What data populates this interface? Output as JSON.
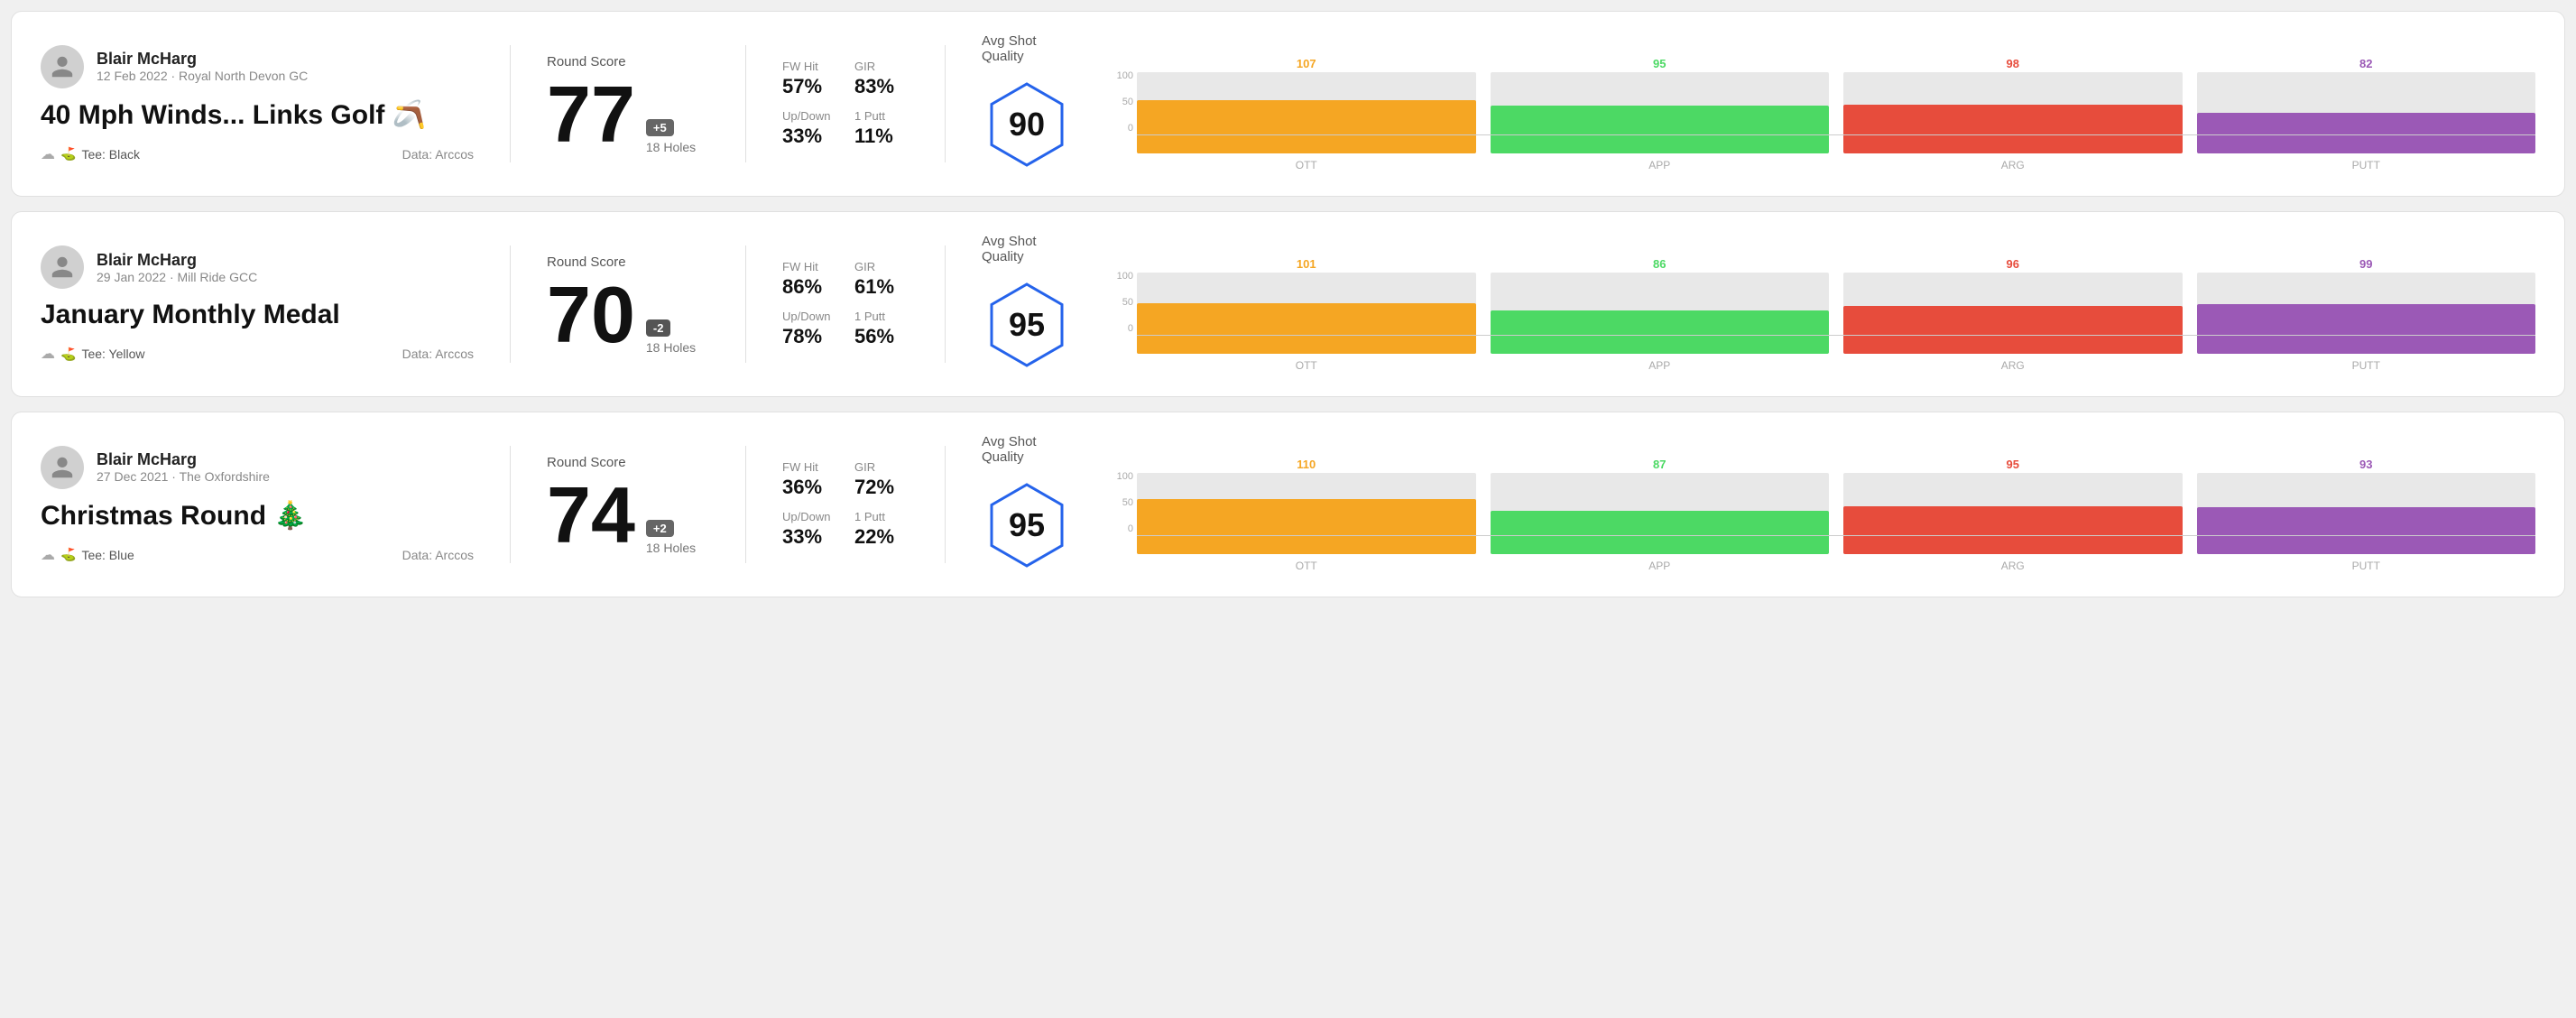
{
  "rounds": [
    {
      "id": "round1",
      "user_name": "Blair McHarg",
      "user_date": "12 Feb 2022 · Royal North Devon GC",
      "title": "40 Mph Winds... Links Golf 🪃",
      "tee": "Black",
      "data_source": "Data: Arccos",
      "score": "77",
      "score_diff": "+5",
      "score_diff_sign": "positive",
      "holes": "18 Holes",
      "fw_hit": "57%",
      "gir": "83%",
      "up_down": "33%",
      "one_putt": "11%",
      "avg_shot_quality": "90",
      "chart": {
        "bars": [
          {
            "label": "OTT",
            "value": 107,
            "color": "#f5a623",
            "max": 130
          },
          {
            "label": "APP",
            "value": 95,
            "color": "#4cd964",
            "max": 130
          },
          {
            "label": "ARG",
            "value": 98,
            "color": "#e74c3c",
            "max": 130
          },
          {
            "label": "PUTT",
            "value": 82,
            "color": "#9b59b6",
            "max": 130
          }
        ]
      }
    },
    {
      "id": "round2",
      "user_name": "Blair McHarg",
      "user_date": "29 Jan 2022 · Mill Ride GCC",
      "title": "January Monthly Medal",
      "tee": "Yellow",
      "data_source": "Data: Arccos",
      "score": "70",
      "score_diff": "-2",
      "score_diff_sign": "negative",
      "holes": "18 Holes",
      "fw_hit": "86%",
      "gir": "61%",
      "up_down": "78%",
      "one_putt": "56%",
      "avg_shot_quality": "95",
      "chart": {
        "bars": [
          {
            "label": "OTT",
            "value": 101,
            "color": "#f5a623",
            "max": 130
          },
          {
            "label": "APP",
            "value": 86,
            "color": "#4cd964",
            "max": 130
          },
          {
            "label": "ARG",
            "value": 96,
            "color": "#e74c3c",
            "max": 130
          },
          {
            "label": "PUTT",
            "value": 99,
            "color": "#9b59b6",
            "max": 130
          }
        ]
      }
    },
    {
      "id": "round3",
      "user_name": "Blair McHarg",
      "user_date": "27 Dec 2021 · The Oxfordshire",
      "title": "Christmas Round 🎄",
      "tee": "Blue",
      "data_source": "Data: Arccos",
      "score": "74",
      "score_diff": "+2",
      "score_diff_sign": "positive",
      "holes": "18 Holes",
      "fw_hit": "36%",
      "gir": "72%",
      "up_down": "33%",
      "one_putt": "22%",
      "avg_shot_quality": "95",
      "chart": {
        "bars": [
          {
            "label": "OTT",
            "value": 110,
            "color": "#f5a623",
            "max": 130
          },
          {
            "label": "APP",
            "value": 87,
            "color": "#4cd964",
            "max": 130
          },
          {
            "label": "ARG",
            "value": 95,
            "color": "#e74c3c",
            "max": 130
          },
          {
            "label": "PUTT",
            "value": 93,
            "color": "#9b59b6",
            "max": 130
          }
        ]
      }
    }
  ],
  "y_axis_labels": [
    "100",
    "50",
    "0"
  ]
}
